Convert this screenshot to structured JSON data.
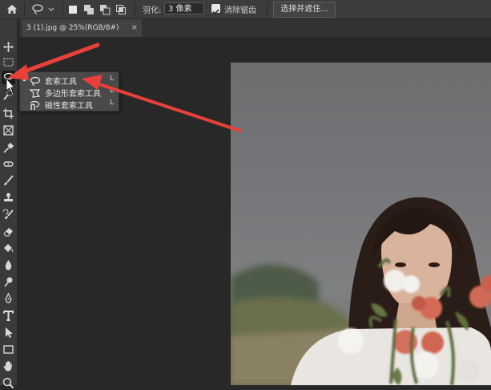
{
  "options_bar": {
    "feather_label": "羽化:",
    "feather_value": "3 像素",
    "anti_alias_label": "消除锯齿",
    "anti_alias_checked": true,
    "select_mask_label": "选择并遮住..."
  },
  "document_tab": {
    "title": "3 (1).jpg @ 25%(RGB/8#)",
    "close_glyph": "×"
  },
  "toolbar": {
    "tools": [
      "move-tool",
      "marquee-tool",
      "lasso-tool",
      "quick-select-tool",
      "crop-tool",
      "frame-tool",
      "eyedropper-tool",
      "spot-heal-tool",
      "brush-tool",
      "stamp-tool",
      "history-brush-tool",
      "eraser-tool",
      "bucket-tool",
      "blur-tool",
      "dodge-tool",
      "pen-tool",
      "type-tool",
      "path-select-tool",
      "rectangle-tool",
      "hand-tool",
      "zoom-tool"
    ],
    "active": "lasso-tool"
  },
  "flyout": {
    "items": [
      {
        "label": "套索工具",
        "shortcut": "L",
        "selected": true
      },
      {
        "label": "多边形套索工具",
        "shortcut": "L",
        "selected": false
      },
      {
        "label": "磁性套索工具",
        "shortcut": "L",
        "selected": false
      }
    ]
  },
  "colors": {
    "accent_arrow": "#e8403a",
    "panel": "#3c3c3c",
    "workspace": "#282828"
  }
}
